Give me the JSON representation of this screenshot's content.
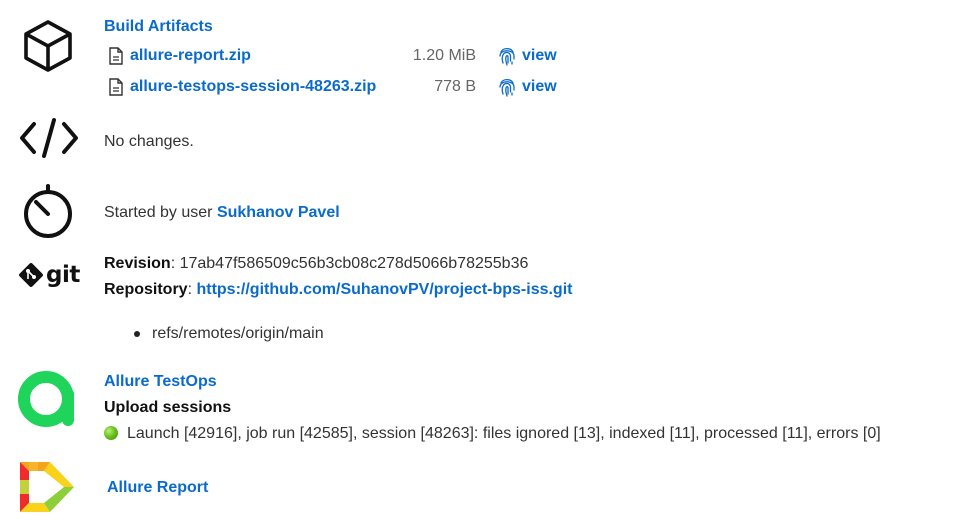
{
  "artifacts": {
    "title": "Build Artifacts",
    "files": [
      {
        "name": "allure-report.zip",
        "size": "1.20 MiB",
        "view_label": "view"
      },
      {
        "name": "allure-testops-session-48263.zip",
        "size": "778 B",
        "view_label": "view"
      }
    ]
  },
  "changes": {
    "text": "No changes."
  },
  "started": {
    "prefix": "Started by user ",
    "user": "Sukhanov Pavel"
  },
  "git": {
    "logo_text": "git",
    "revision_label": "Revision",
    "revision": ": 17ab47f586509c56b3cb08c278d5066b78255b36",
    "repository_label": "Repository",
    "repository_sep": ": ",
    "repository_url": "https://github.com/SuhanovPV/project-bps-iss.git",
    "refs": [
      "refs/remotes/origin/main"
    ]
  },
  "testops": {
    "title": "Allure TestOps",
    "subtitle": "Upload sessions",
    "session_text": "Launch [42916], job run [42585], session [48263]: files ignored [13], indexed [11], processed [11], errors [0]"
  },
  "report": {
    "title": "Allure Report"
  },
  "colors": {
    "link": "#0b6bcb",
    "testops_green": "#1ed45a",
    "status_ok": "#6cc21e"
  }
}
